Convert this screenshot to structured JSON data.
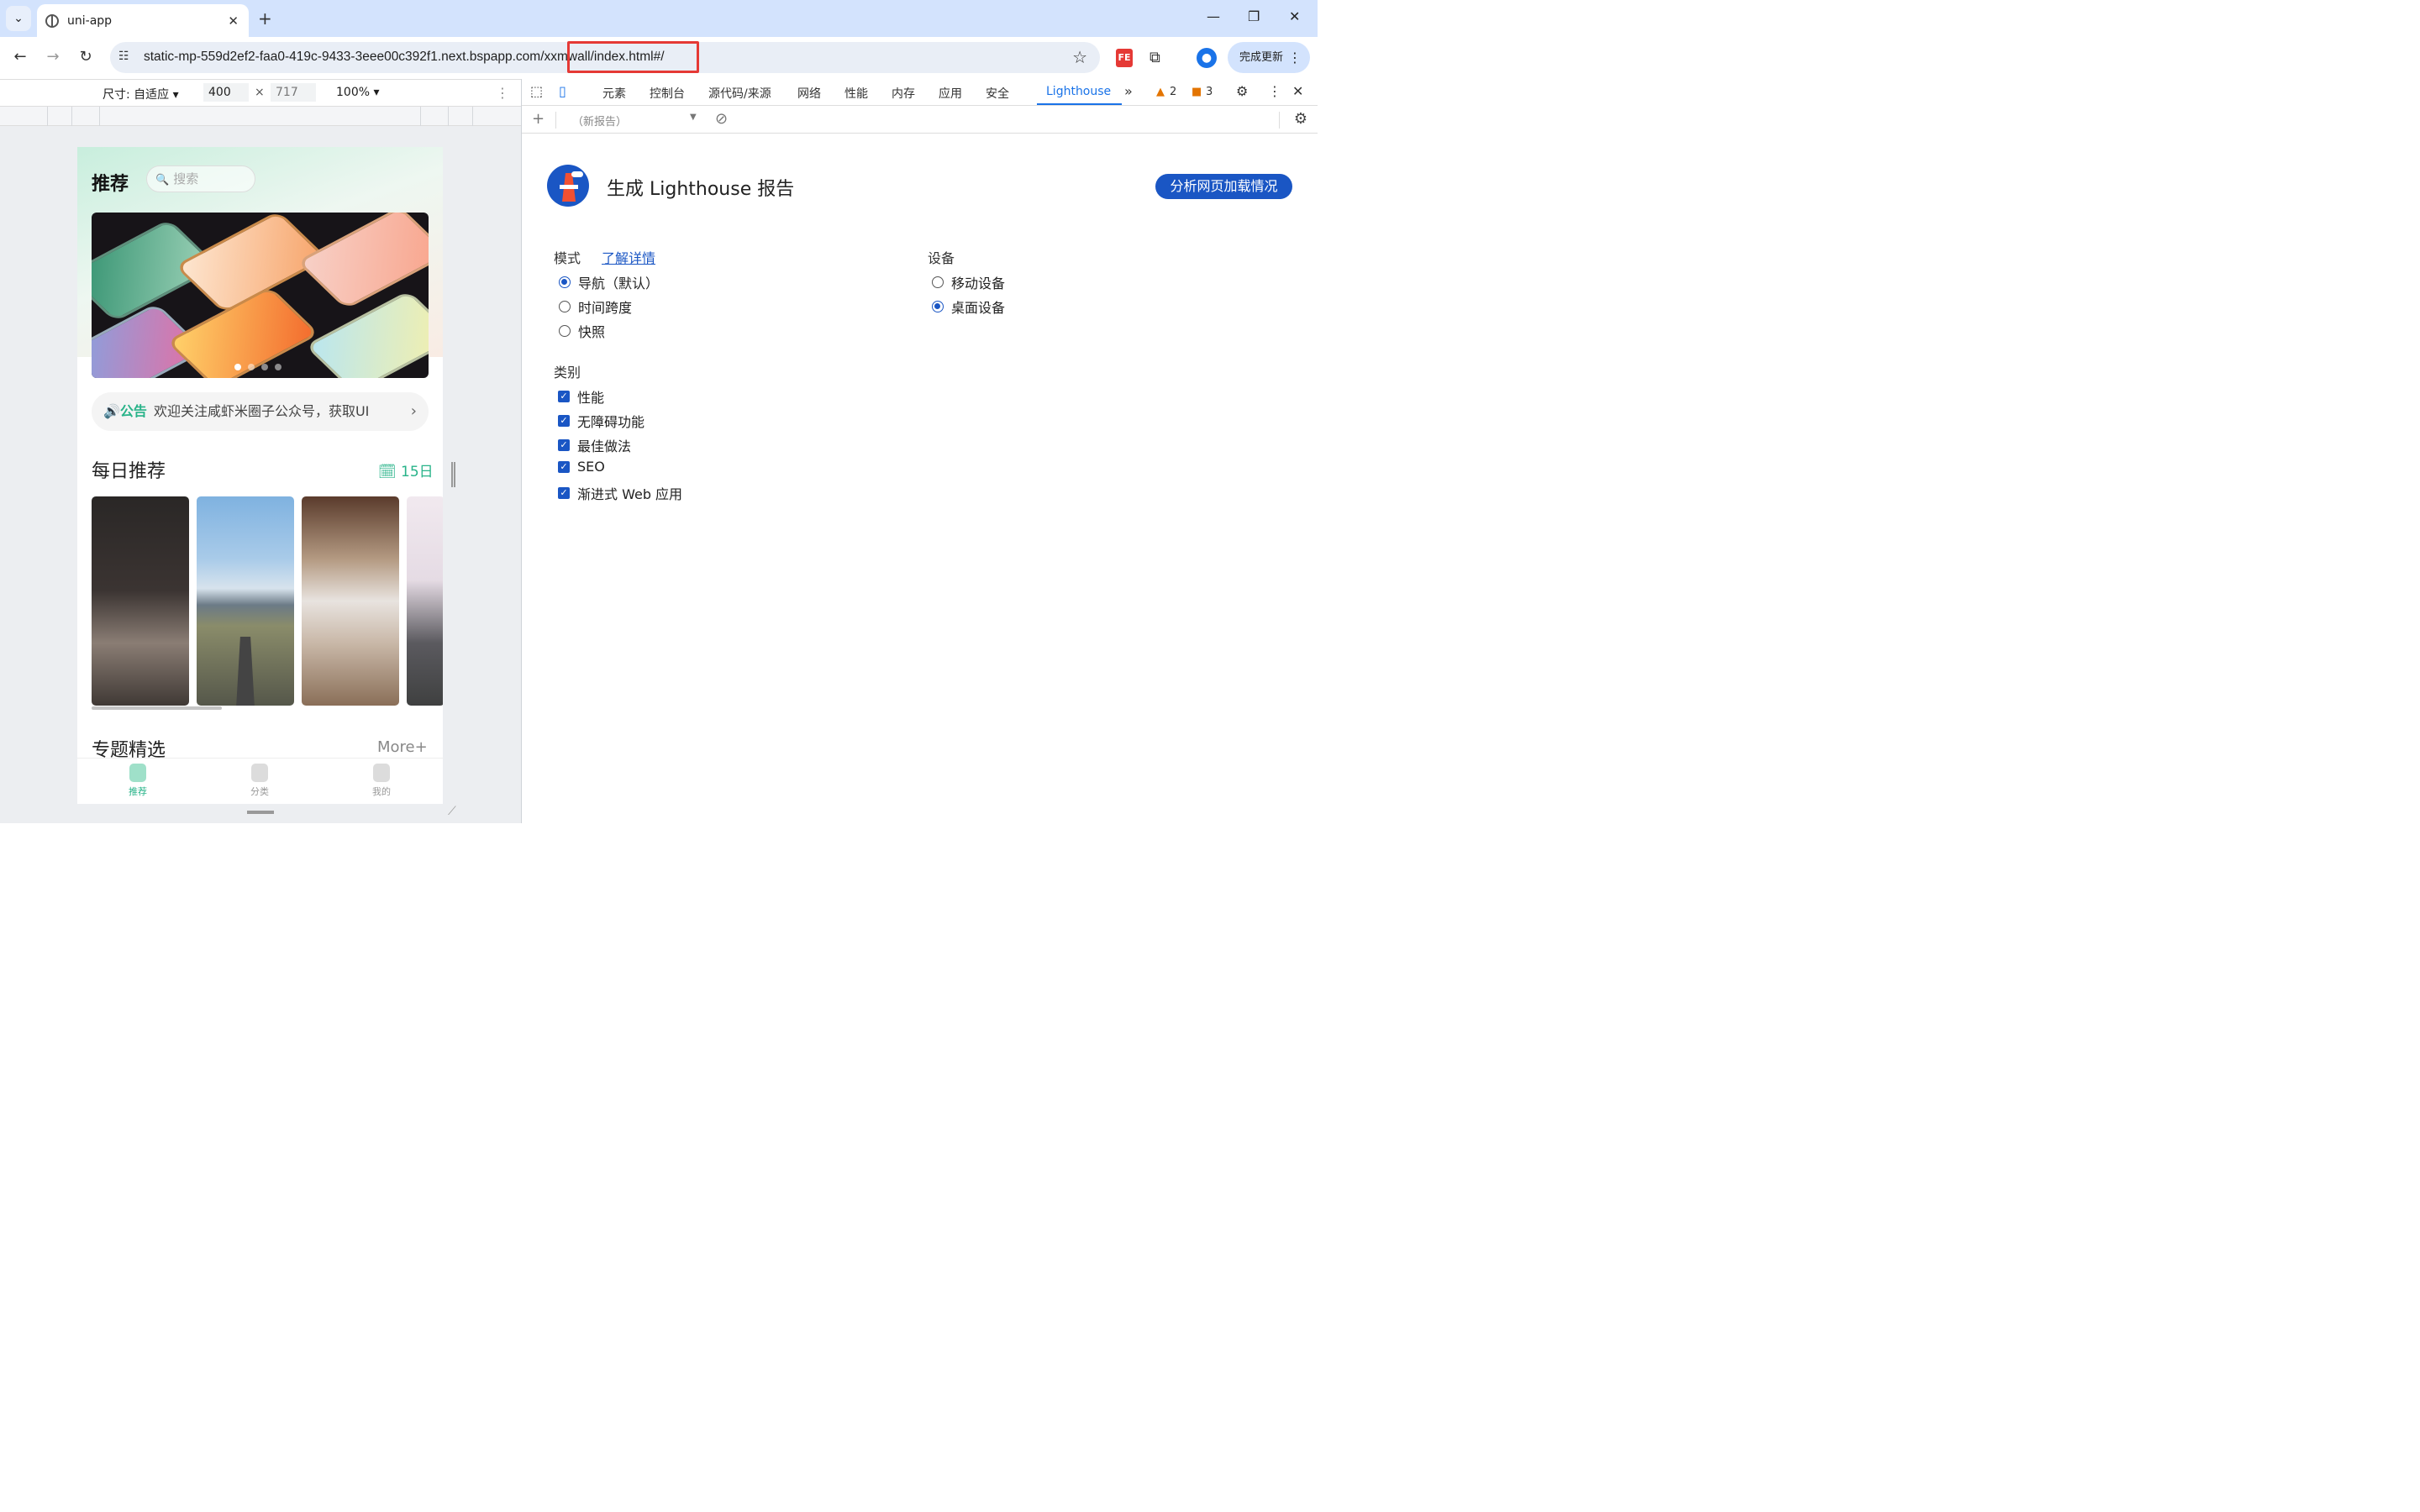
{
  "browser": {
    "tab_title": "uni-app",
    "url_host": "static-mp-559d2ef2-faa0-419c-9433-3eee00c392f1.next.bspapp.com/",
    "url_path": "xxmwall/index.html#/",
    "update_label": "完成更新",
    "warn_count": "2",
    "issue_count": "3"
  },
  "device_toolbar": {
    "size_label": "尺寸: 自适应 ▾",
    "width": "400",
    "height": "717",
    "zoom": "100% ▾"
  },
  "app": {
    "title": "推荐",
    "search_placeholder": "搜索",
    "notice_tag": "公告",
    "notice_text": "欢迎关注咸虾米圈子公众号，获取UI",
    "daily_title": "每日推荐",
    "daily_date": "15日",
    "topic_title": "专题精选",
    "more_label": "More+",
    "tabs": [
      "推荐",
      "分类",
      "我的"
    ]
  },
  "devtools": {
    "tabs": [
      "元素",
      "控制台",
      "源代码/来源",
      "网络",
      "性能",
      "内存",
      "应用",
      "安全",
      "Lighthouse"
    ],
    "report_select": "（新报告）"
  },
  "lighthouse": {
    "title": "生成 Lighthouse 报告",
    "analyze_button": "分析网页加载情况",
    "mode_label": "模式",
    "learn_more": "了解详情",
    "modes": [
      "导航（默认）",
      "时间跨度",
      "快照"
    ],
    "device_label": "设备",
    "devices": [
      "移动设备",
      "桌面设备"
    ],
    "category_label": "类别",
    "categories": [
      "性能",
      "无障碍功能",
      "最佳做法",
      "SEO",
      "渐进式 Web 应用"
    ]
  },
  "colors": {
    "accent": "#1a56c4",
    "app_green": "#28b389",
    "highlight_box": "#e53935"
  }
}
